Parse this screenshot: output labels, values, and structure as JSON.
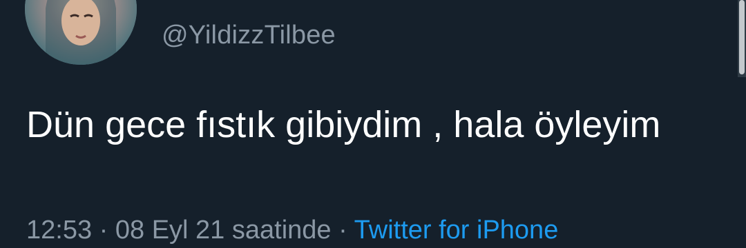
{
  "tweet": {
    "handle": "@YildizzTilbee",
    "text": "Dün gece fıstık gibiydim , hala öyleyim",
    "time": "12:53",
    "separator": "·",
    "date": "08 Eyl 21 saatinde",
    "source": "Twitter for iPhone"
  },
  "colors": {
    "background": "#15202b",
    "text": "#ffffff",
    "muted": "#8b98a5",
    "link": "#1d9bf0"
  },
  "icons": {
    "avatar": "profile-photo"
  }
}
